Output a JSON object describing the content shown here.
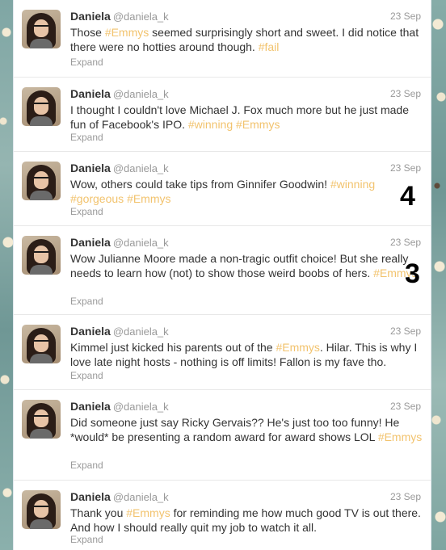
{
  "tweets": [
    {
      "name": "Daniela",
      "handle": "@daniela_k",
      "time": "23 Sep",
      "parts": [
        {
          "t": "Those ",
          "h": false
        },
        {
          "t": "#Emmys",
          "h": true
        },
        {
          "t": " seemed surprisingly short and sweet. I did notice that there were no hotties around though. ",
          "h": false
        },
        {
          "t": "#fail",
          "h": true
        }
      ],
      "expand": "Expand"
    },
    {
      "name": "Daniela",
      "handle": "@daniela_k",
      "time": "23 Sep",
      "parts": [
        {
          "t": "I thought I couldn't love Michael J. Fox much more but he just made fun of Facebook's IPO. ",
          "h": false
        },
        {
          "t": "#winning",
          "h": true
        },
        {
          "t": " ",
          "h": false
        },
        {
          "t": "#Emmys",
          "h": true
        }
      ],
      "expand": "Expand"
    },
    {
      "name": "Daniela",
      "handle": "@daniela_k",
      "time": "23 Sep",
      "parts": [
        {
          "t": "Wow, others could take tips from Ginnifer Goodwin! ",
          "h": false
        },
        {
          "t": "#winning",
          "h": true
        },
        {
          "t": " ",
          "h": false
        },
        {
          "t": "#gorgeous",
          "h": true
        },
        {
          "t": " ",
          "h": false
        },
        {
          "t": "#Emmys",
          "h": true
        }
      ],
      "expand": "Expand",
      "badge": "4"
    },
    {
      "name": "Daniela",
      "handle": "@daniela_k",
      "time": "23 Sep",
      "parts": [
        {
          "t": "Wow Julianne Moore made a non-tragic outfit choice! But she really needs to learn how (not) to show those weird boobs of hers. ",
          "h": false
        },
        {
          "t": "#Emmys",
          "h": true
        }
      ],
      "expand": "Expand",
      "badge": "3"
    },
    {
      "name": "Daniela",
      "handle": "@daniela_k",
      "time": "23 Sep",
      "parts": [
        {
          "t": "Kimmel just kicked his parents out of the ",
          "h": false
        },
        {
          "t": "#Emmys",
          "h": true
        },
        {
          "t": ". Hilar. This is why I love late night hosts - nothing is off limits! Fallon is my fave tho.",
          "h": false
        }
      ],
      "expand": "Expand"
    },
    {
      "name": "Daniela",
      "handle": "@daniela_k",
      "time": "23 Sep",
      "parts": [
        {
          "t": "Did someone just say Ricky Gervais?? He's just too too funny! He *would* be presenting a random award for award shows LOL ",
          "h": false
        },
        {
          "t": "#Emmys",
          "h": true
        }
      ],
      "expand": "Expand"
    },
    {
      "name": "Daniela",
      "handle": "@daniela_k",
      "time": "23 Sep",
      "parts": [
        {
          "t": "Thank you ",
          "h": false
        },
        {
          "t": "#Emmys",
          "h": true
        },
        {
          "t": " for reminding me how much good TV is out there. And how I should really quit my job to watch it all.",
          "h": false
        }
      ],
      "expand": "Expand"
    }
  ],
  "colors": {
    "hashtag": "#f2c36e",
    "name": "#333333",
    "meta": "#999999"
  }
}
